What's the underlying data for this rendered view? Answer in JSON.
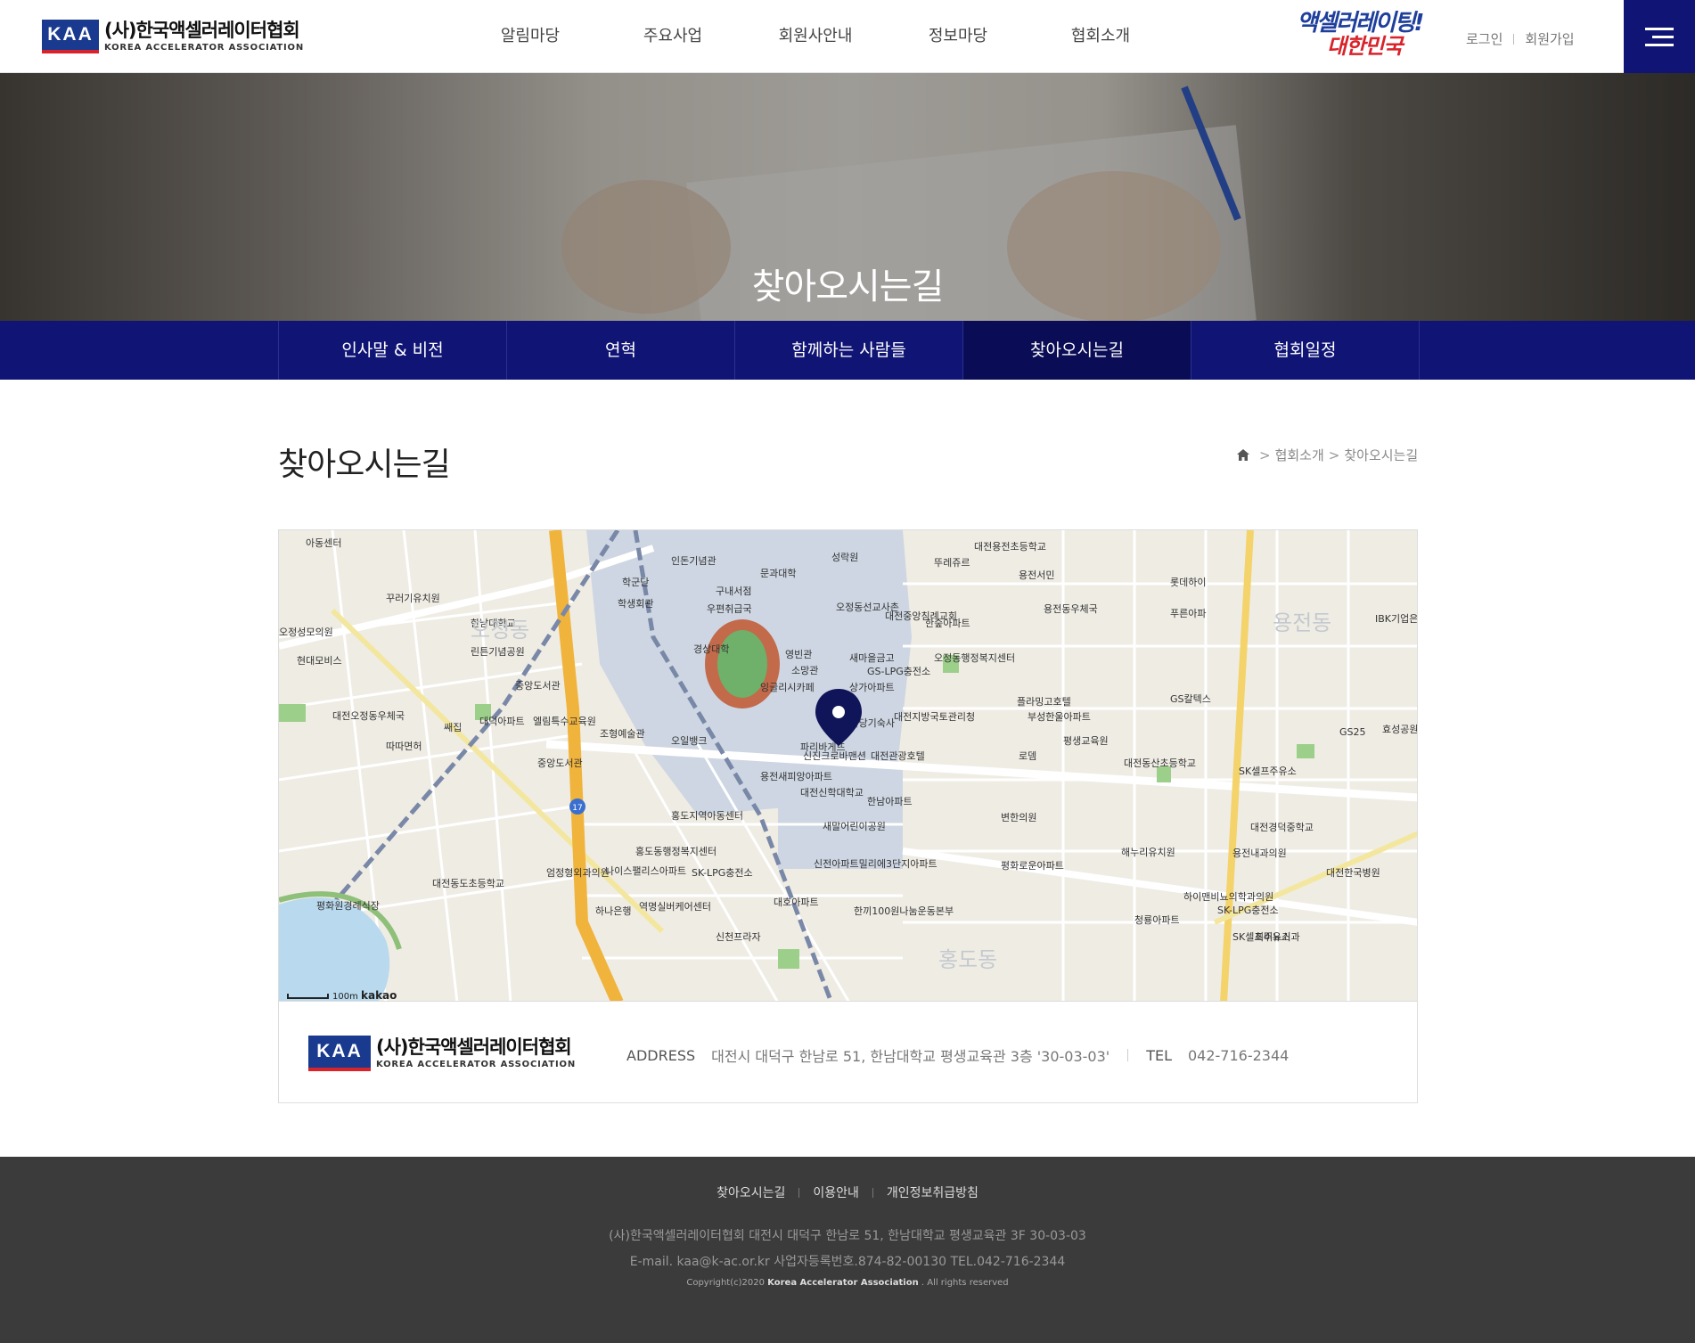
{
  "header": {
    "logo_mark": "KAA",
    "logo_ko": "(사)한국액셀러레이터협회",
    "logo_en": "KOREA ACCELERATOR ASSOCIATION",
    "gnb": [
      "알림마당",
      "주요사업",
      "회원사안내",
      "정보마당",
      "협회소개"
    ],
    "slogan_line1": "액셀러레이팅!",
    "slogan_line2": "대한민국",
    "login": "로그인",
    "join": "회원가입"
  },
  "hero": {
    "title": "찾아오시는길"
  },
  "subnav": {
    "items": [
      "인사말 & 비전",
      "연혁",
      "함께하는 사람들",
      "찾아오시는길",
      "협회일정"
    ],
    "active": "찾아오시는길"
  },
  "content": {
    "title": "찾아오시는길",
    "breadcrumb": [
      "협회소개",
      "찾아오시는길"
    ]
  },
  "map": {
    "labels": [
      "아동센터",
      "인돈기념관",
      "문과대학",
      "성락원",
      "뚜레쥬르",
      "대전용전초등학교",
      "용전서민",
      "롯데하이",
      "학군단",
      "구내서점",
      "꾸러기유치원",
      "학생회관",
      "우편취급국",
      "오정동선교사촌",
      "대전중앙침례교회",
      "한숲아파트",
      "용전동우체국",
      "푸른아파",
      "IBK기업은행",
      "오정성모의원",
      "한남대학교",
      "경상대학",
      "영빈관",
      "새마을금고",
      "오정동행정복지센터",
      "현대모비스",
      "린튼기념공원",
      "소망관",
      "GS-LPG충전소",
      "중앙도서관",
      "잉글리시카페",
      "상가아파트",
      "플라밍고호텔",
      "GS칼텍스",
      "대전오정동우체국",
      "대덕아파트",
      "엘림특수교육원",
      "조형예술관",
      "한국어학당기숙사",
      "대전지방국토관리청",
      "부성한울아파트",
      "GS25",
      "효성공원",
      "쌔집",
      "오일뱅크",
      "평생교육원",
      "따따면허",
      "파리바게뜨",
      "신진크로바맨션",
      "대전관광호텔",
      "로뎀",
      "중앙도서관",
      "용전새피앙아파트",
      "SK셀프주유소",
      "대전동산초등학교",
      "대전신학대학교",
      "한남아파트",
      "홍도지역아동센터",
      "변한의원",
      "대전경덕중학교",
      "새말어린이공원",
      "홍도동행정복지센터",
      "해누리유치원",
      "용전내과의원",
      "엄정형외과의원",
      "나이스팰리스아파트",
      "SK-LPG충전소",
      "신전아파트밀리에3단지아파트",
      "평화로운아파트",
      "대전한국병원",
      "대전동도초등학교",
      "하나은행",
      "역명실버케어센터",
      "대호아파트",
      "한끼100원나눔운동본부",
      "하이맨비뇨의학과의원",
      "SK-LPG충전소",
      "청룡아파트",
      "SK셀프주유소",
      "최비뇨기과",
      "신천프라자",
      "평화원경례식장"
    ],
    "areas": [
      "오정동",
      "용전동",
      "홍도동"
    ],
    "scale": "100m",
    "brand": "kakao",
    "road_number": "17"
  },
  "info": {
    "address_label": "ADDRESS",
    "address": "대전시 대덕구 한남로 51, 한남대학교 평생교육관 3층 '30-03-03'",
    "tel_label": "TEL",
    "tel": "042-716-2344"
  },
  "footer": {
    "links": [
      "찾아오시는길",
      "이용안내",
      "개인정보취급방침"
    ],
    "line1": "(사)한국액셀러레이터협회 대전시 대덕구 한남로 51, 한남대학교 평생교육관 3F 30-03-03",
    "line2": "E-mail. kaa@k-ac.or.kr 사업자등록번호.874-82-00130 TEL.042-716-2344",
    "copy_prefix": "Copyright(c)2020",
    "copy_brand": "Korea Accelerator Association",
    "copy_suffix": ". All rights reserved"
  },
  "colors": {
    "primary": "#101474",
    "active_sub": "#0a0d55",
    "footer_bg": "#3b3b3b",
    "accent_red": "#d8232a"
  }
}
